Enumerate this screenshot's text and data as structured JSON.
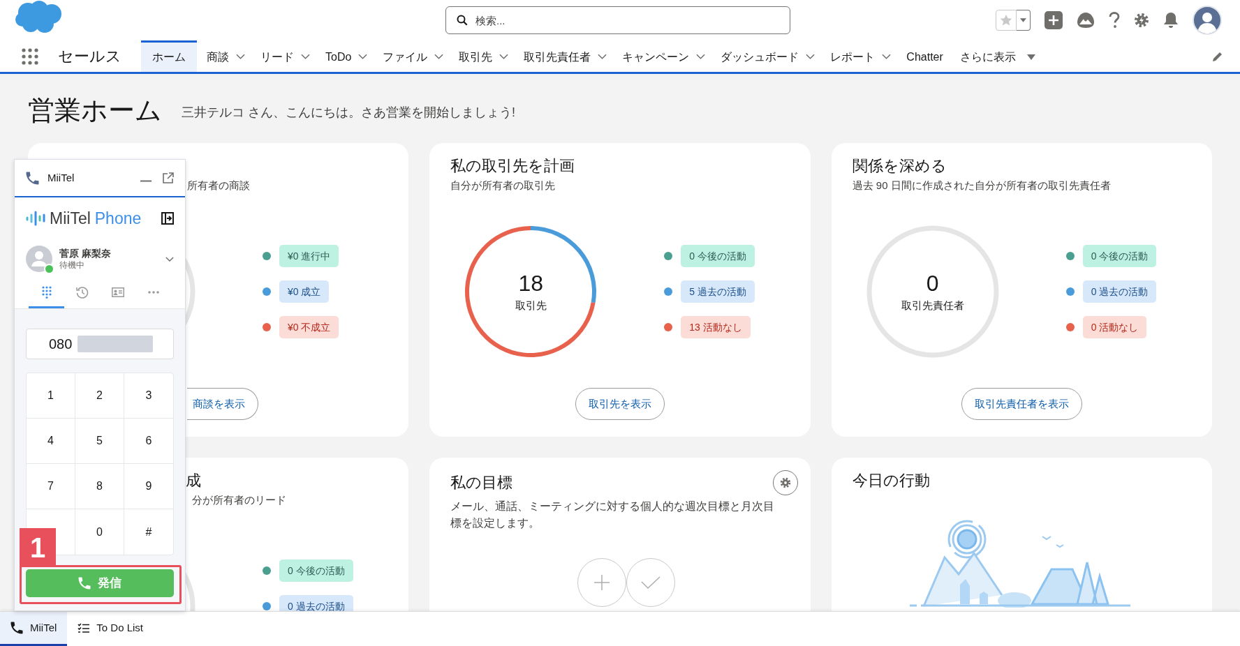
{
  "header": {
    "search": {
      "placeholder": "検索..."
    }
  },
  "nav": {
    "app_name": "セールス",
    "tabs": [
      {
        "label": "ホーム",
        "selected": true,
        "kind": "plain"
      },
      {
        "label": "商談",
        "selected": false,
        "kind": "menu"
      },
      {
        "label": "リード",
        "selected": false,
        "kind": "menu"
      },
      {
        "label": "ToDo",
        "selected": false,
        "kind": "menu"
      },
      {
        "label": "ファイル",
        "selected": false,
        "kind": "menu"
      },
      {
        "label": "取引先",
        "selected": false,
        "kind": "menu"
      },
      {
        "label": "取引先責任者",
        "selected": false,
        "kind": "menu"
      },
      {
        "label": "キャンペーン",
        "selected": false,
        "kind": "menu"
      },
      {
        "label": "ダッシュボード",
        "selected": false,
        "kind": "menu"
      },
      {
        "label": "レポート",
        "selected": false,
        "kind": "menu"
      },
      {
        "label": "Chatter",
        "selected": false,
        "kind": "plain"
      },
      {
        "label": "さらに表示",
        "selected": false,
        "kind": "more"
      }
    ]
  },
  "page": {
    "title": "営業ホーム",
    "greeting": "三井テルコ さん、こんにちは。さあ営業を開始しましょう!"
  },
  "cards": [
    {
      "kind": "summary",
      "subtitle": "所有者の商談",
      "legend": [
        {
          "label": "¥0 進行中",
          "color": "#4a9f90"
        },
        {
          "label": "¥0 成立",
          "color": "#4a9bd9"
        },
        {
          "label": "¥0 不成立",
          "color": "#e8614d"
        }
      ],
      "button": "商談を表示"
    },
    {
      "kind": "summary",
      "title": "私の取引先を計画",
      "subtitle": "自分が所有者の取引先",
      "chart_data": {
        "type": "donut",
        "categories": [
          "今後の活動",
          "過去の活動",
          "活動なし"
        ],
        "values": [
          0,
          5,
          13
        ],
        "value_labels": [
          "0",
          "5",
          "13"
        ],
        "colors": [
          "#4a9f90",
          "#4a9bd9",
          "#e8614d"
        ],
        "legend": "right"
      },
      "center_value": "18",
      "center_label": "取引先",
      "button": "取引先を表示"
    },
    {
      "kind": "summary",
      "title": "関係を深める",
      "subtitle": "過去 90 日間に作成された自分が所有者の取引先責任者",
      "legend": [
        {
          "label": "0 今後の活動",
          "color": "#4a9f90"
        },
        {
          "label": "0 過去の活動",
          "color": "#4a9bd9"
        },
        {
          "label": "0 活動なし",
          "color": "#e8614d"
        }
      ],
      "center_value": "0",
      "center_label": "取引先責任者",
      "button": "取引先責任者を表示"
    },
    {
      "kind": "summary",
      "title": "成",
      "subtitle": "分が所有者のリード",
      "legend": [
        {
          "label": "0 今後の活動",
          "color": "#4a9f90"
        },
        {
          "label": "0 過去の活動",
          "color": "#4a9bd9"
        }
      ]
    },
    {
      "kind": "goals",
      "title": "私の目標",
      "description": "メール、通話、ミーティングに対する個人的な週次目標と月次目標を設定します。"
    },
    {
      "kind": "illustration",
      "title": "今日の行動"
    }
  ],
  "phone_widget": {
    "title": "MiiTel",
    "brand": "MiiTel",
    "brand_suffix": "Phone",
    "user": {
      "name": "菅原 麻梨奈",
      "status": "待機中",
      "online": true
    },
    "tabs": [
      {
        "kind": "dialpad",
        "selected": true
      },
      {
        "kind": "history",
        "selected": false
      },
      {
        "kind": "contacts",
        "selected": false
      },
      {
        "kind": "more",
        "selected": false
      }
    ],
    "number": "080",
    "keys": [
      {
        "label": "1"
      },
      {
        "label": "2"
      },
      {
        "label": "3"
      },
      {
        "label": "4"
      },
      {
        "label": "5"
      },
      {
        "label": "6"
      },
      {
        "label": "7"
      },
      {
        "label": "8"
      },
      {
        "label": "9"
      },
      {
        "kind": "covered"
      },
      {
        "label": "0"
      },
      {
        "label": "#"
      }
    ],
    "call_button": "発信",
    "annotation": "1"
  },
  "utility_bar": {
    "items": [
      {
        "label": "MiiTel",
        "kind": "phone",
        "selected": true
      },
      {
        "label": "To Do List",
        "kind": "list",
        "selected": false
      }
    ]
  }
}
